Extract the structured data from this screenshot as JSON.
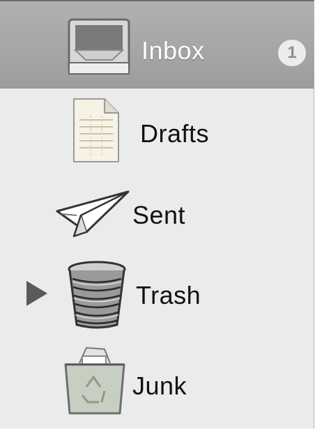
{
  "mailboxes": [
    {
      "label": "Inbox",
      "icon": "inbox-tray-icon",
      "badge": "1",
      "selected": true
    },
    {
      "label": "Drafts",
      "icon": "draft-document-icon"
    },
    {
      "label": "Sent",
      "icon": "paper-plane-icon"
    },
    {
      "label": "Trash",
      "icon": "wastebasket-icon",
      "collapsed_disclosure": true
    },
    {
      "label": "Junk",
      "icon": "junk-bin-icon"
    }
  ],
  "colors": {
    "sidebar_bg": "#ebebeb",
    "selection_bg": "#a7a7a7",
    "badge_bg": "#ececec",
    "badge_text": "#8e8e8e"
  }
}
